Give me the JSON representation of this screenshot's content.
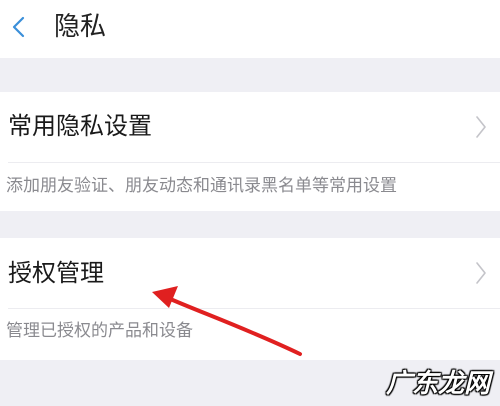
{
  "header": {
    "title": "隐私",
    "back_icon": "chevron-left-icon",
    "accent_color": "#3a8fd9"
  },
  "sections": [
    {
      "title": "常用隐私设置",
      "description": "添加朋友验证、朋友动态和通讯录黑名单等常用设置",
      "chevron_icon": "chevron-right-icon"
    },
    {
      "title": "授权管理",
      "description": "管理已授权的产品和设备",
      "chevron_icon": "chevron-right-icon"
    }
  ],
  "annotation": {
    "arrow_color": "#e02020",
    "points_to": "授权管理"
  },
  "watermark": {
    "text": "广东龙网"
  }
}
